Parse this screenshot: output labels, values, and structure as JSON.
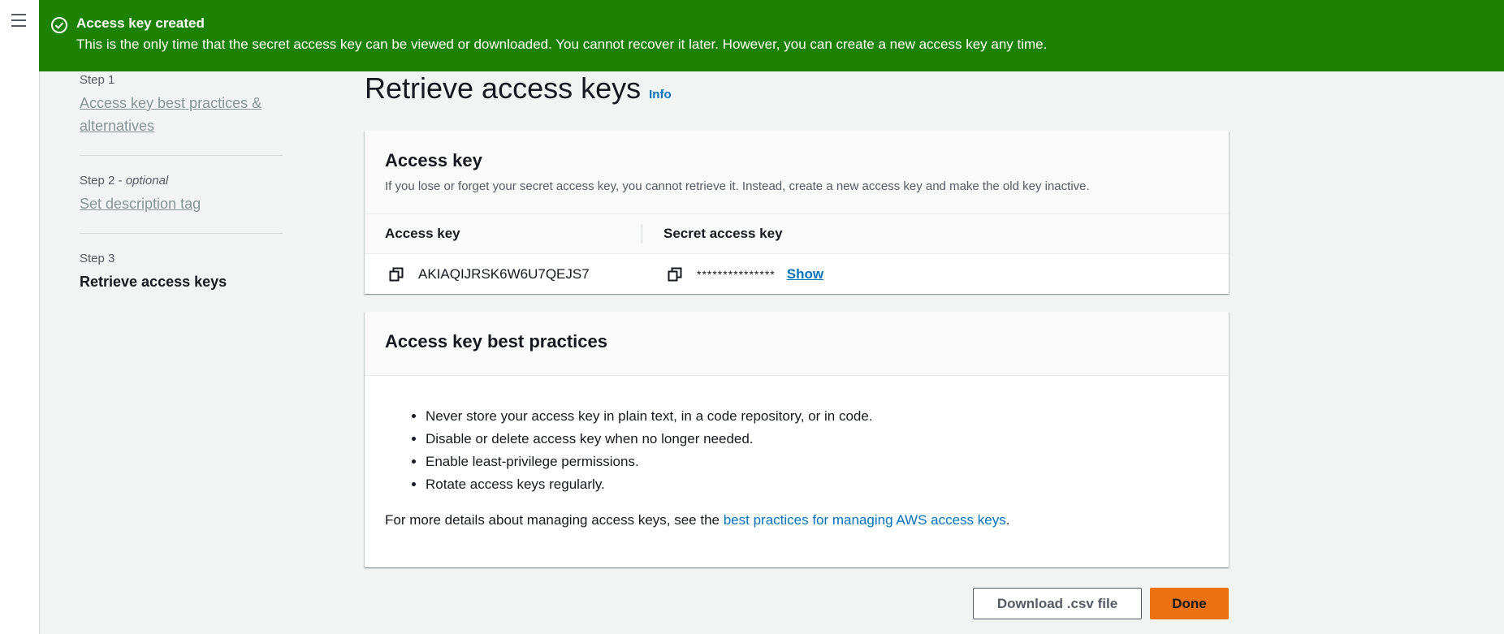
{
  "flash": {
    "icon": "check-circle-icon",
    "title": "Access key created",
    "message": "This is the only time that the secret access key can be viewed or downloaded. You cannot recover it later. However, you can create a new access key any time.",
    "color": "#1d8102"
  },
  "steps": [
    {
      "num": "Step 1",
      "label": "Access key best practices & alternatives"
    },
    {
      "num": "Step 2 - ",
      "optional": "optional",
      "label": "Set description tag"
    },
    {
      "num": "Step 3",
      "label": "Retrieve access keys"
    }
  ],
  "page": {
    "title": "Retrieve access keys",
    "info": "Info"
  },
  "access_key_panel": {
    "title": "Access key",
    "description": "If you lose or forget your secret access key, you cannot retrieve it. Instead, create a new access key and make the old key inactive.",
    "col_access_key": "Access key",
    "col_secret_key": "Secret access key",
    "access_key_value": "AKIAQIJRSK6W6U7QEJS7",
    "secret_masked": "***************",
    "show_label": "Show"
  },
  "best_practices_panel": {
    "title": "Access key best practices",
    "items": [
      "Never store your access key in plain text, in a code repository, or in code.",
      "Disable or delete access key when no longer needed.",
      "Enable least-privilege permissions.",
      "Rotate access keys regularly."
    ],
    "details_prefix": "For more details about managing access keys, see the ",
    "details_link": "best practices for managing AWS access keys",
    "details_suffix": "."
  },
  "actions": {
    "download_label": "Download .csv file",
    "done_label": "Done"
  }
}
